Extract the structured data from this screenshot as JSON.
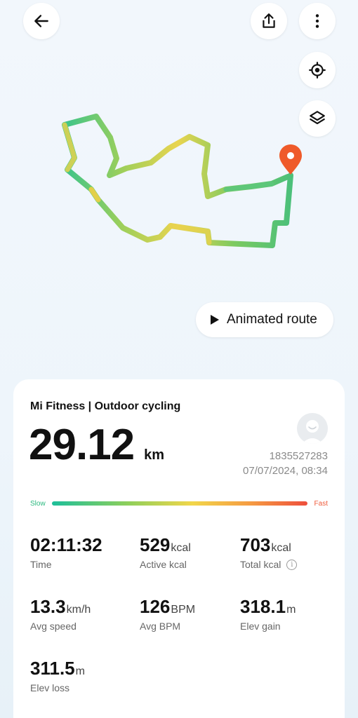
{
  "header": {
    "back_icon": "arrow-left-icon",
    "share_icon": "share-icon",
    "more_icon": "more-vertical-icon"
  },
  "map": {
    "locate_icon": "locate-icon",
    "layers_icon": "layers-icon",
    "marker_icon": "location-pin-icon",
    "marker_color": "#ef5a2a",
    "animated_route_label": "Animated route"
  },
  "summary": {
    "app_title": "Mi Fitness | Outdoor cycling",
    "distance_value": "29.12",
    "distance_unit": "km",
    "user_id": "1835527283",
    "datetime": "07/07/2024, 08:34"
  },
  "legend": {
    "slow_label": "Slow",
    "fast_label": "Fast",
    "slow_color": "#1dbf9a",
    "fast_color": "#ee4e3c"
  },
  "stats": [
    {
      "value": "02:11:32",
      "unit": "",
      "label": "Time"
    },
    {
      "value": "529",
      "unit": "kcal",
      "label": "Active kcal"
    },
    {
      "value": "703",
      "unit": "kcal",
      "label": "Total kcal"
    },
    {
      "value": "13.3",
      "unit": "km/h",
      "label": "Avg speed"
    },
    {
      "value": "126",
      "unit": "BPM",
      "label": "Avg BPM"
    },
    {
      "value": "318.1",
      "unit": "m",
      "label": "Elev gain"
    },
    {
      "value": "311.5",
      "unit": "m",
      "label": "Elev loss"
    }
  ]
}
